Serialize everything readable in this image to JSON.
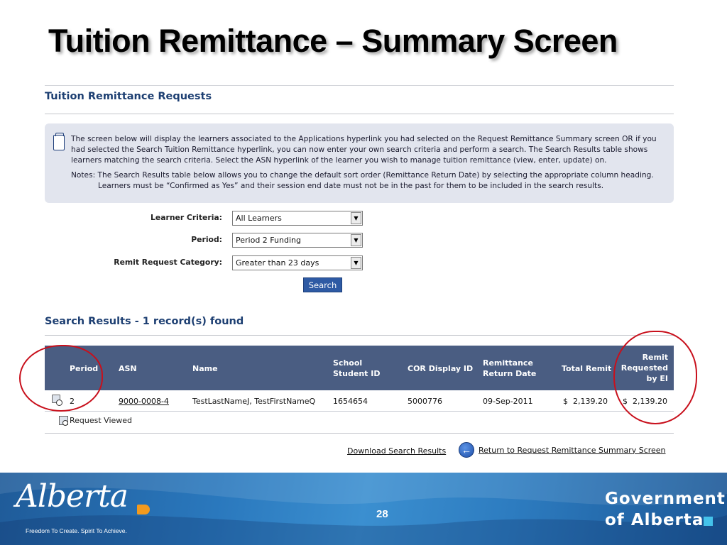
{
  "slide": {
    "title": "Tuition Remittance – Summary Screen",
    "page_number": "28"
  },
  "page": {
    "heading": "Tuition Remittance Requests"
  },
  "info": {
    "description": "The screen below will display the learners associated to the Applications hyperlink you had selected on the Request Remittance Summary screen OR if you had selected the Search Tuition Remittance hyperlink, you can now enter your own search criteria and perform a search. The Search Results table shows learners matching the search criteria. Select the ASN hyperlink of the learner you wish to manage tuition remittance (view, enter, update) on.",
    "notes_line1": "Notes:  The Search Results table below allows you to change the default sort order (Remittance Return Date) by selecting the appropriate column heading.",
    "notes_line2": "Learners must be “Confirmed as Yes” and their session end date must not be in the past for them to be included in the search results.",
    "icon": "document-icon"
  },
  "form": {
    "learner_criteria_label": "Learner Criteria:",
    "learner_criteria_value": "All Learners",
    "period_label": "Period:",
    "period_value": "Period 2 Funding",
    "remit_category_label": "Remit Request Category:",
    "remit_category_value": "Greater than 23 days",
    "search_button": "Search"
  },
  "results": {
    "heading": "Search Results - 1 record(s) found",
    "columns": {
      "period": "Period",
      "asn": "ASN",
      "name": "Name",
      "school_student_id_1": "School",
      "school_student_id_2": "Student ID",
      "cor_display_id": "COR Display ID",
      "remittance_return_date_1": "Remittance",
      "remittance_return_date_2": "Return Date",
      "total_remit": "Total Remit",
      "remit_requested_1": "Remit",
      "remit_requested_2": "Requested",
      "remit_requested_3": "by EI"
    },
    "rows": [
      {
        "period": "2",
        "asn": "9000-0008-4",
        "name": "TestLastNameJ, TestFirstNameQ",
        "school_student_id": "1654654",
        "cor_display_id": "5000776",
        "remittance_return_date": "09-Sep-2011",
        "total_remit": "$  2,139.20",
        "remit_requested": "$  2,139.20"
      }
    ],
    "legend": "Request Viewed",
    "download_link": "Download Search Results",
    "return_link": "Return to Request Remittance Summary Screen"
  },
  "footer": {
    "logo_word": "Alberta",
    "tagline": "Freedom To Create. Spirit To Achieve.",
    "government_line1": "Government",
    "government_line2": "of Alberta"
  },
  "colors": {
    "heading_blue": "#1d3f72",
    "table_header": "#4a5d82",
    "info_box": "#e2e5ee",
    "annotation_red": "#c8101c",
    "footer_blue": "#2a78bd",
    "logo_orange": "#f39a1e",
    "accent_cyan": "#44c2ea"
  }
}
